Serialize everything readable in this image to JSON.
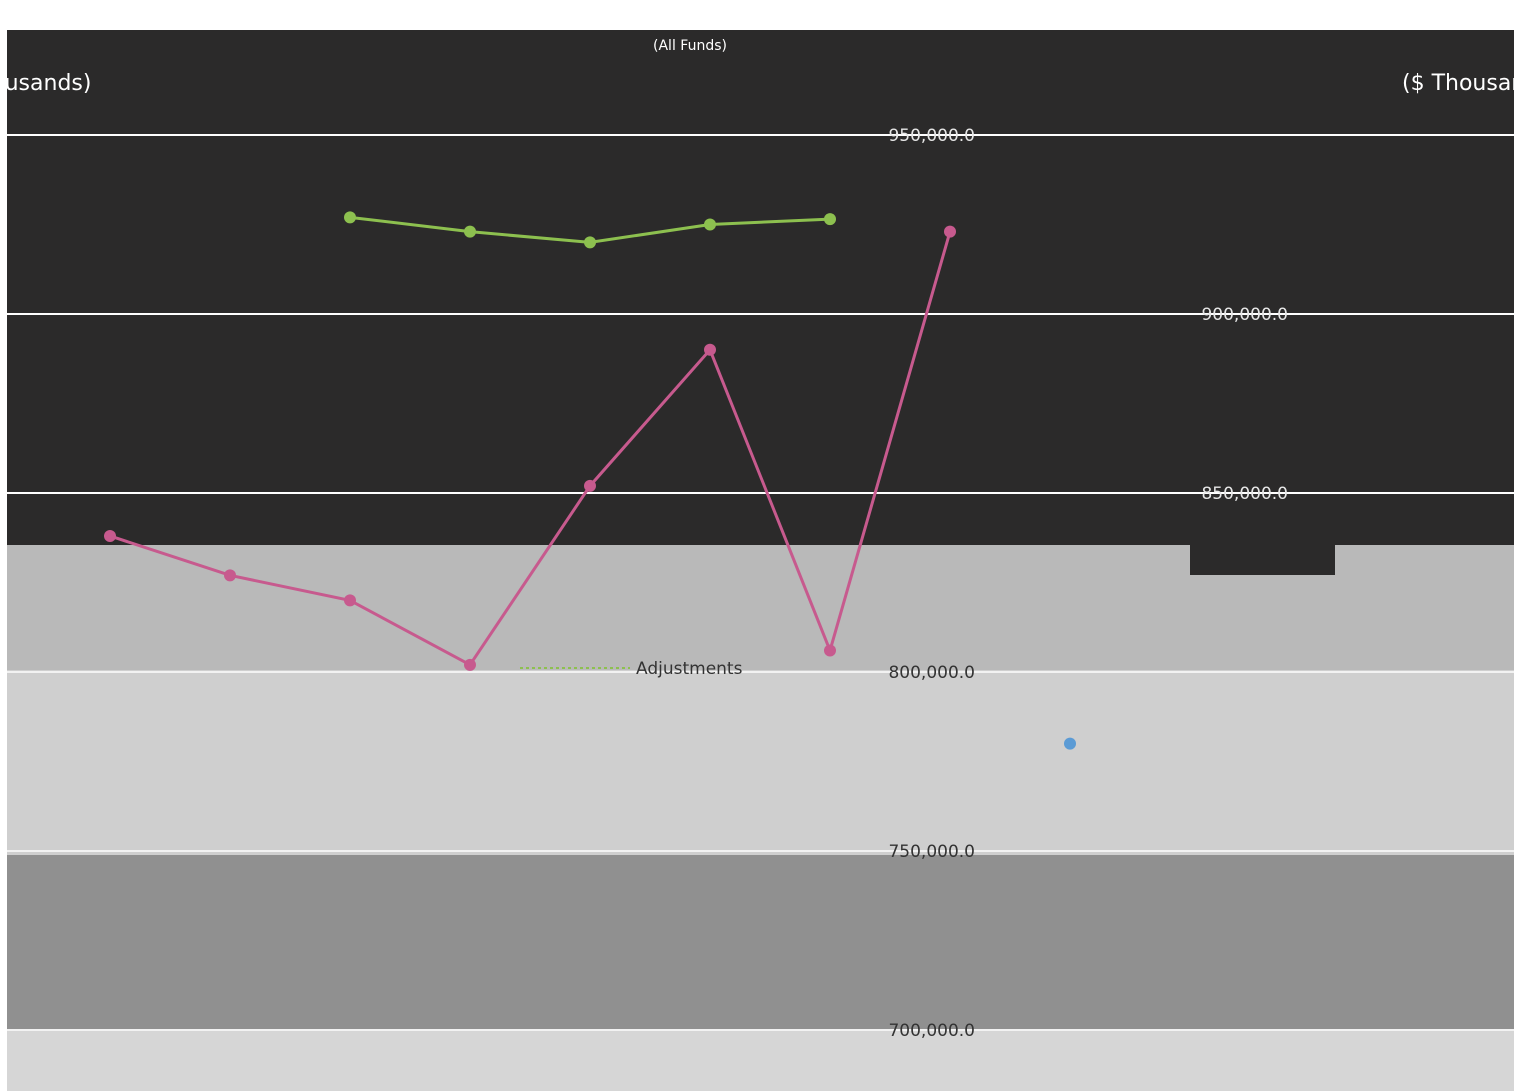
{
  "header": {
    "title": "",
    "subtitle": "(All Funds)"
  },
  "axes": {
    "left_unit": "(thousands)",
    "right_unit": "($ Thousands)"
  },
  "colors": {
    "background": "#2b2a2a",
    "band_light": "#b9b9b9",
    "band_mid": "#cfcfcf",
    "band_dark": "#909090",
    "grid": "#ffffff",
    "series_green": "#8dc04f",
    "series_pink": "#c75a8e",
    "series_blue": "#5b9bd5"
  },
  "chart_data": {
    "type": "line",
    "title": "",
    "subtitle": "(All Funds)",
    "ylabel": "($ Thousands)",
    "ylim": [
      700000,
      950000
    ],
    "y_ticks": [
      "950,000.0",
      "900,000.0",
      "850,000.0",
      "800,000.0",
      "750,000.0",
      "700,000.0"
    ],
    "legend_label": "Adjustments",
    "x": [
      0,
      1,
      2,
      3,
      4,
      5,
      6,
      7,
      8,
      9,
      10,
      11
    ],
    "series": [
      {
        "color": "#8dc04f",
        "values": [
          null,
          null,
          927000,
          923000,
          920000,
          925000,
          926500,
          null,
          null,
          null,
          null,
          null
        ]
      },
      {
        "color": "#c75a8e",
        "values": [
          838000,
          827000,
          820000,
          802000,
          852000,
          890000,
          806000,
          923000,
          null,
          null,
          null,
          null
        ]
      },
      {
        "color": "#5b9bd5",
        "values": [
          null,
          null,
          null,
          null,
          null,
          null,
          null,
          null,
          780000,
          null,
          null,
          null
        ]
      }
    ]
  }
}
